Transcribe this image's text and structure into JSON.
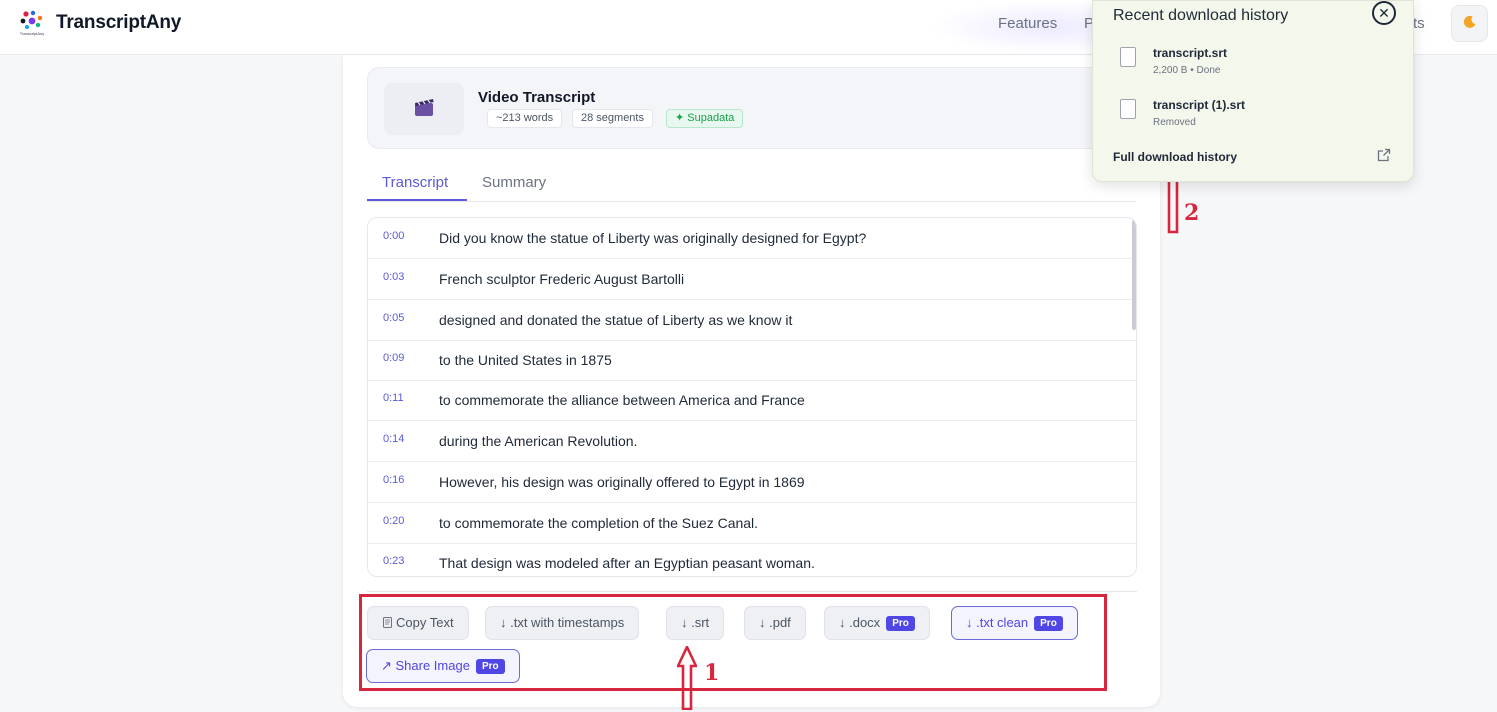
{
  "nav": {
    "brand": "TranscriptAny",
    "logo_caption": "TranscriptAny",
    "links": [
      "Features",
      "P",
      "ts"
    ],
    "theme_icon": "moon-icon"
  },
  "video": {
    "title": "Video Transcript",
    "words": "~213 words",
    "segments": "28 segments",
    "source": "✦ Supadata",
    "thumb_icon": "clapperboard-icon"
  },
  "tabs": {
    "transcript": "Transcript",
    "summary": "Summary"
  },
  "transcript": [
    {
      "time": "0:00",
      "text": "Did you know the statue of Liberty was originally designed for Egypt?"
    },
    {
      "time": "0:03",
      "text": "French sculptor Frederic August Bartolli"
    },
    {
      "time": "0:05",
      "text": "designed and donated the statue of Liberty as we know it"
    },
    {
      "time": "0:09",
      "text": "to the United States in 1875"
    },
    {
      "time": "0:11",
      "text": "to commemorate the alliance between America and France"
    },
    {
      "time": "0:14",
      "text": "during the American Revolution."
    },
    {
      "time": "0:16",
      "text": "However, his design was originally offered to Egypt in 1869"
    },
    {
      "time": "0:20",
      "text": "to commemorate the completion of the Suez Canal."
    },
    {
      "time": "0:23",
      "text": "That design was modeled after an Egyptian peasant woman."
    }
  ],
  "actions": {
    "copy": "Copy Text",
    "txt_ts": "↓ .txt with timestamps",
    "srt": "↓ .srt",
    "pdf": "↓ .pdf",
    "docx": "↓ .docx",
    "txt_clean": "↓ .txt clean",
    "share": "↗ Share Image",
    "pro": "Pro",
    "copy_icon": "copy-icon"
  },
  "downloads": {
    "title": "Recent download history",
    "items": [
      {
        "name": "transcript.srt",
        "meta": "2,200 B • Done"
      },
      {
        "name": "transcript (1).srt",
        "meta": "Removed"
      }
    ],
    "full_history": "Full download history"
  },
  "annotations": {
    "one": "1",
    "two": "2"
  },
  "colors": {
    "accent": "#5b5bd6",
    "pro_badge": "#4f46e5",
    "annotation": "#d7263d",
    "popover_bg": "#f3f7ec",
    "source_chip": "#16a34a"
  }
}
